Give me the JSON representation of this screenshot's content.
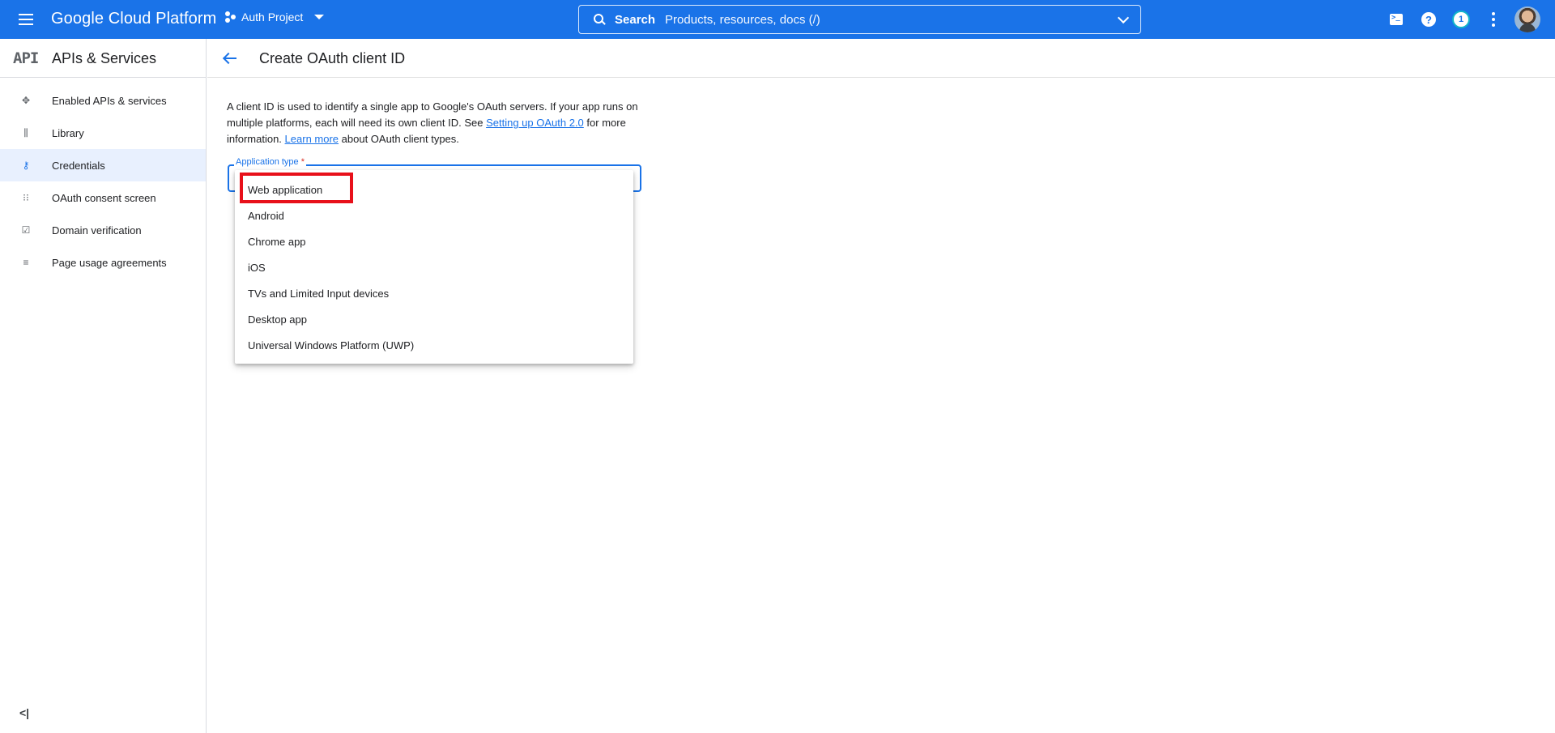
{
  "topbar": {
    "brand": "Google Cloud Platform",
    "project": "Auth Project",
    "search_label": "Search",
    "search_placeholder": "Products, resources, docs (/)",
    "notifications_count": "1",
    "help_glyph": "?"
  },
  "sidebar": {
    "logo": "API",
    "title": "APIs & Services",
    "items": [
      {
        "label": "Enabled APIs & services",
        "icon": "diamond-dots-icon",
        "active": false
      },
      {
        "label": "Library",
        "icon": "library-icon",
        "active": false
      },
      {
        "label": "Credentials",
        "icon": "key-icon",
        "active": true
      },
      {
        "label": "OAuth consent screen",
        "icon": "consent-grid-icon",
        "active": false
      },
      {
        "label": "Domain verification",
        "icon": "checkbox-icon",
        "active": false
      },
      {
        "label": "Page usage agreements",
        "icon": "settings-list-icon",
        "active": false
      }
    ],
    "collapse_glyph": "<|"
  },
  "main": {
    "title": "Create OAuth client ID",
    "desc": {
      "part1": "A client ID is used to identify a single app to Google's OAuth servers. If your app runs on multiple platforms, each will need its own client ID. See ",
      "link1": "Setting up OAuth 2.0",
      "part2": " for more information. ",
      "link2": "Learn more",
      "part3": " about OAuth client types."
    },
    "field_label": "Application type",
    "required_mark": "*",
    "options": [
      "Web application",
      "Android",
      "Chrome app",
      "iOS",
      "TVs and Limited Input devices",
      "Desktop app",
      "Universal Windows Platform (UWP)"
    ]
  },
  "colors": {
    "accent": "#1a73e8",
    "active_nav_bg": "#e8f0fe",
    "highlight": "#e8101a"
  }
}
